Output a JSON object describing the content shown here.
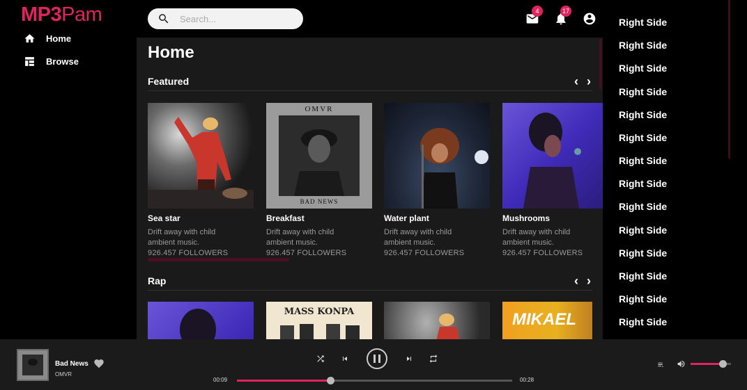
{
  "app": {
    "logo_main": "MP3",
    "logo_rest": "Pam"
  },
  "sidebar": {
    "items": [
      {
        "label": "Home",
        "icon": "home-icon"
      },
      {
        "label": "Browse",
        "icon": "browse-icon"
      }
    ]
  },
  "topbar": {
    "search_placeholder": "Search...",
    "mail_count": "4",
    "notifications_count": "17"
  },
  "main": {
    "page_title": "Home",
    "sections": [
      {
        "title": "Featured",
        "cards": [
          {
            "name": "Sea star",
            "desc": "Drift away with child ambient music.",
            "followers": "926.457 FOLLOWERS"
          },
          {
            "name": "Breakfast",
            "desc": "Drift away with child ambient music.",
            "followers": "926.457 FOLLOWERS",
            "art_top": "OMVR",
            "art_bottom": "BAD NEWS"
          },
          {
            "name": "Water plant",
            "desc": "Drift away with child ambient music.",
            "followers": "926.457 FOLLOWERS"
          },
          {
            "name": "Mushrooms",
            "desc": "Drift away with child ambient music.",
            "followers": "926.457 FOLLOWERS"
          }
        ]
      },
      {
        "title": "Rap",
        "cards": [
          {
            "art_text": ""
          },
          {
            "art_text": "MASS KONPA"
          },
          {
            "art_text": ""
          },
          {
            "art_text": "MIKAEL"
          }
        ]
      }
    ],
    "prev_arrow": "‹",
    "next_arrow": "›"
  },
  "right_side": {
    "items": [
      "Right Side",
      "Right Side",
      "Right Side",
      "Right Side",
      "Right Side",
      "Right Side",
      "Right Side",
      "Right Side",
      "Right Side",
      "Right Side",
      "Right Side",
      "Right Side",
      "Right Side",
      "Right Side"
    ]
  },
  "player": {
    "title": "Bad News",
    "artist": "OMVR",
    "current_time": "00:09",
    "total_time": "00:28",
    "progress": 0.34,
    "volume": 0.8
  },
  "colors": {
    "accent": "#e0245e",
    "background": "#000000",
    "main_bg": "#1a1a1a",
    "player_bg": "#1b1b1b"
  }
}
